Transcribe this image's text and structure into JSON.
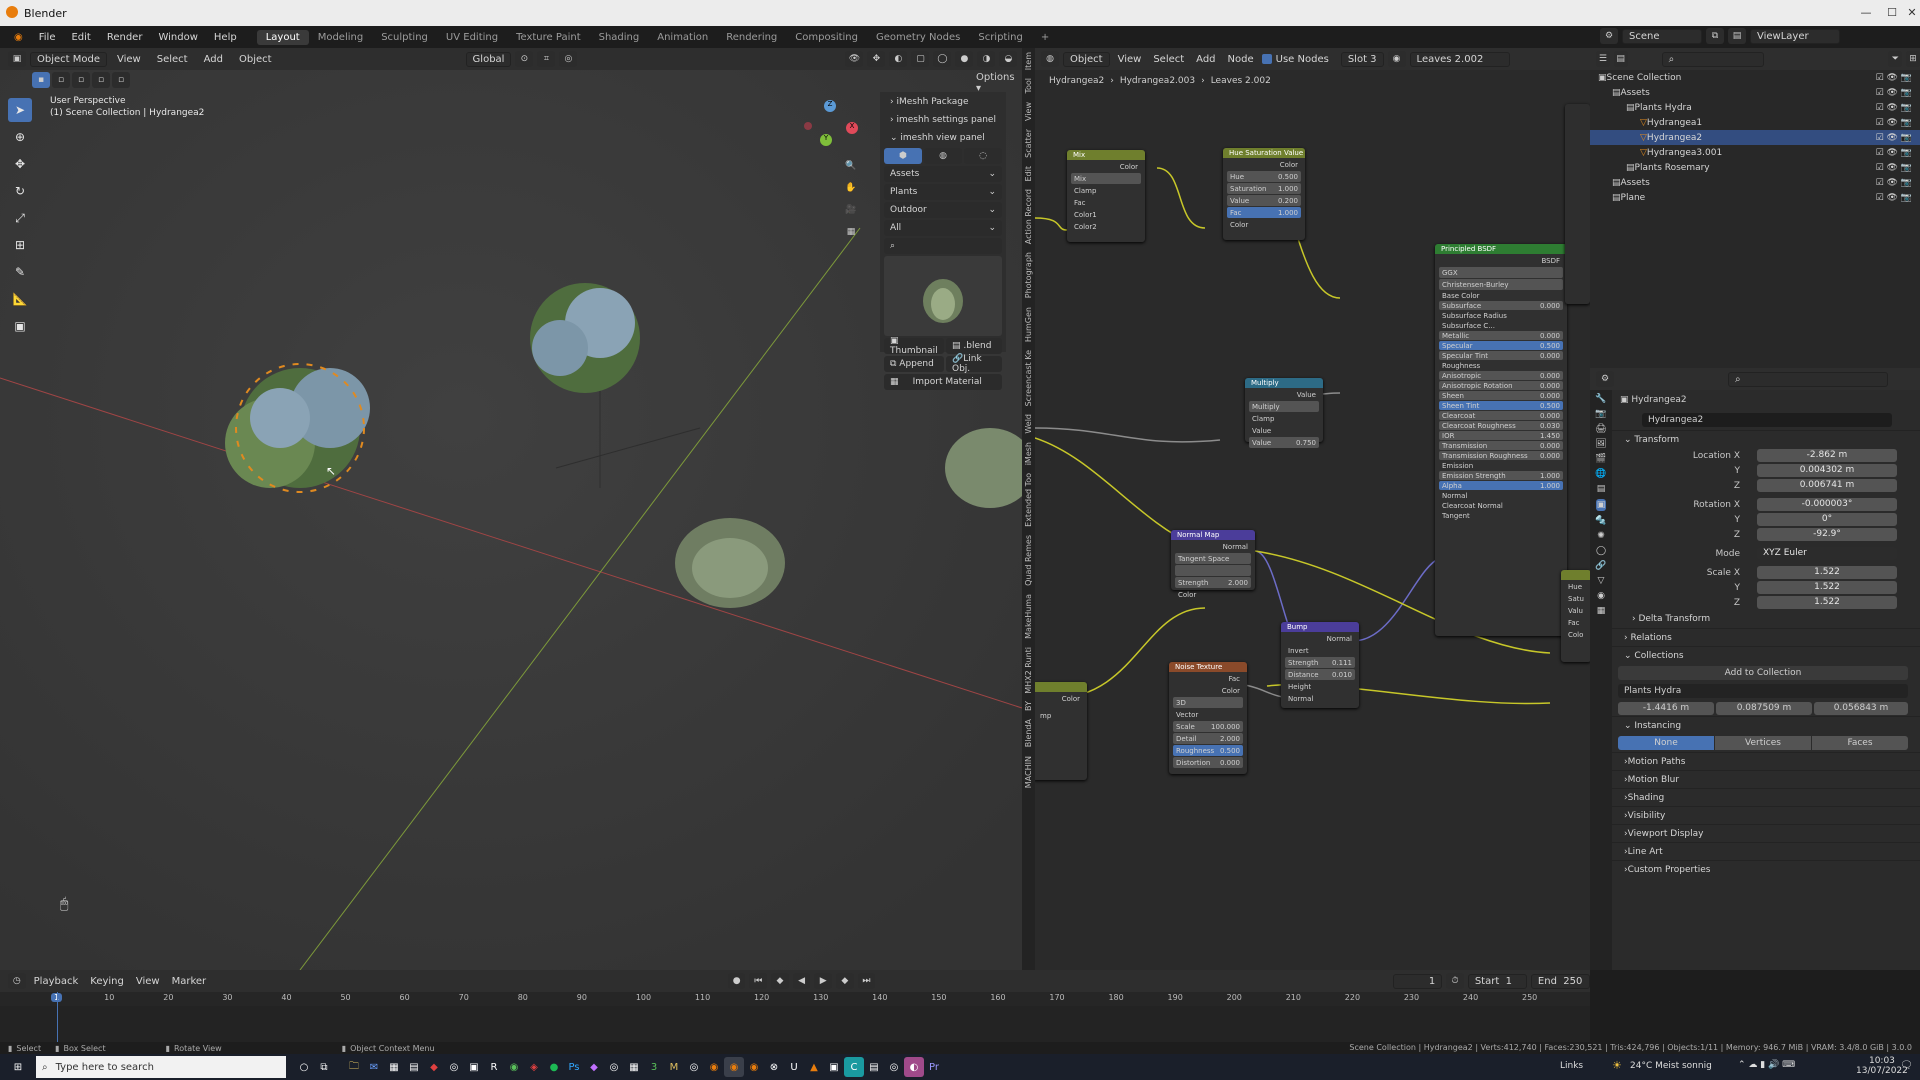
{
  "app": {
    "title": "Blender"
  },
  "menu": [
    "File",
    "Edit",
    "Render",
    "Window",
    "Help"
  ],
  "workspaces": [
    "Layout",
    "Modeling",
    "Sculpting",
    "UV Editing",
    "Texture Paint",
    "Shading",
    "Animation",
    "Rendering",
    "Compositing",
    "Geometry Nodes",
    "Scripting"
  ],
  "workspace_add": "+",
  "viewport": {
    "mode": "Object Mode",
    "menus": [
      "View",
      "Select",
      "Add",
      "Object"
    ],
    "transform": "Global",
    "options": "Options",
    "perspective": "User Perspective",
    "collection": "(1) Scene Collection | Hydrangea2"
  },
  "gizmo": {
    "x": "X",
    "y": "Y",
    "z": "Z"
  },
  "imeshh": {
    "package": "iMeshh Package",
    "settings": "imeshh settings panel",
    "view": "imeshh view panel",
    "dropdowns": [
      "Assets",
      "Plants",
      "Outdoor",
      "All"
    ],
    "thumbnail": "Thumbnail",
    "blend": ".blend",
    "append": "Append",
    "link": "Link Obj.",
    "import": "Import Material"
  },
  "sidebar_tabs": [
    "Item",
    "Tool",
    "View",
    "Scatter",
    "Edit",
    "Action Record",
    "Photograph",
    "HumGen",
    "Screencast Ke",
    "Weld",
    "iMesh",
    "Extended Too",
    "Quad Remes",
    "MakeHuma",
    "MHX2 Runti",
    "BY",
    "BlendA",
    "MACHIN"
  ],
  "node_editor": {
    "menus": [
      "View",
      "Select",
      "Add",
      "Node"
    ],
    "object": "Object",
    "use_nodes": "Use Nodes",
    "slot": "Slot 3",
    "material": "Leaves 2.002",
    "breadcrumb": [
      "Hydrangea2",
      "Hydrangea2.003",
      "Leaves 2.002"
    ]
  },
  "nodes": {
    "mix": {
      "title": "Mix",
      "out": "Color",
      "blend": "Mix",
      "clamp": "Clamp",
      "fac": "Fac",
      "c1": "Color1",
      "c2": "Color2"
    },
    "hsv": {
      "title": "Hue Saturation Value",
      "out": "Color",
      "hue": "Hue",
      "hue_v": "0.500",
      "sat": "Saturation",
      "sat_v": "1.000",
      "val": "Value",
      "val_v": "0.200",
      "fac": "Fac",
      "fac_v": "1.000",
      "color": "Color"
    },
    "bsdf": {
      "title": "Principled BSDF",
      "out": "BSDF",
      "dist": "GGX",
      "sss": "Christensen-Burley",
      "rows": [
        [
          "Base Color",
          ""
        ],
        [
          "Subsurface",
          "0.000"
        ],
        [
          "Subsurface Radius",
          ""
        ],
        [
          "Subsurface C...",
          ""
        ],
        [
          "Metallic",
          "0.000"
        ],
        [
          "Specular",
          "0.500"
        ],
        [
          "Specular Tint",
          "0.000"
        ],
        [
          "Roughness",
          ""
        ],
        [
          "Anisotropic",
          "0.000"
        ],
        [
          "Anisotropic Rotation",
          "0.000"
        ],
        [
          "Sheen",
          "0.000"
        ],
        [
          "Sheen Tint",
          "0.500"
        ],
        [
          "Clearcoat",
          "0.000"
        ],
        [
          "Clearcoat Roughness",
          "0.030"
        ],
        [
          "IOR",
          "1.450"
        ],
        [
          "Transmission",
          "0.000"
        ],
        [
          "Transmission Roughness",
          "0.000"
        ],
        [
          "Emission",
          ""
        ],
        [
          "Emission Strength",
          "1.000"
        ],
        [
          "Alpha",
          "1.000"
        ],
        [
          "Normal",
          ""
        ],
        [
          "Clearcoat Normal",
          ""
        ],
        [
          "Tangent",
          ""
        ]
      ]
    },
    "multiply": {
      "title": "Multiply",
      "out": "Value",
      "op": "Multiply",
      "clamp": "Clamp",
      "v1": "Value",
      "v2": "Value",
      "v2_v": "0.750"
    },
    "normalmap": {
      "title": "Normal Map",
      "out": "Normal",
      "space": "Tangent Space",
      "strength": "Strength",
      "strength_v": "2.000",
      "color": "Color"
    },
    "bump": {
      "title": "Bump",
      "out": "Normal",
      "invert": "Invert",
      "strength": "Strength",
      "strength_v": "0.111",
      "distance": "Distance",
      "distance_v": "0.010",
      "height": "Height",
      "normal": "Normal"
    },
    "noise": {
      "title": "Noise Texture",
      "fac": "Fac",
      "color": "Color",
      "dim": "3D",
      "vector": "Vector",
      "scale": "Scale",
      "scale_v": "100.000",
      "detail": "Detail",
      "detail_v": "2.000",
      "rough": "Roughness",
      "rough_v": "0.500",
      "distortion": "Distortion",
      "distortion_v": "0.000"
    },
    "partial": {
      "color": "Color",
      "mp": "mp"
    },
    "right_partial": [
      "Hue",
      "Satu",
      "Valu",
      "Fac",
      "Colo"
    ]
  },
  "outliner": {
    "scene": "Scene",
    "viewlayer": "ViewLayer",
    "rows": [
      {
        "label": "Scene Collection",
        "indent": 0
      },
      {
        "label": "Assets",
        "indent": 1
      },
      {
        "label": "Plants Hydra",
        "indent": 2
      },
      {
        "label": "Hydrangea1",
        "indent": 3
      },
      {
        "label": "Hydrangea2",
        "indent": 3,
        "sel": true
      },
      {
        "label": "Hydrangea3.001",
        "indent": 3
      },
      {
        "label": "Plants Rosemary",
        "indent": 2
      },
      {
        "label": "Assets",
        "indent": 1
      },
      {
        "label": "Plane",
        "indent": 1
      }
    ]
  },
  "properties": {
    "object": "Hydrangea2",
    "name_field": "Hydrangea2",
    "transform": "Transform",
    "location_label": "Location X",
    "loc": [
      "-2.862 m",
      "0.004302 m",
      "0.006741 m"
    ],
    "rotation_label": "Rotation X",
    "rot": [
      "-0.000003°",
      "0°",
      "-92.9°"
    ],
    "mode_label": "Mode",
    "mode": "XYZ Euler",
    "scale_label": "Scale X",
    "scale": [
      "1.522",
      "1.522",
      "1.522"
    ],
    "y": "Y",
    "z": "Z",
    "delta": "Delta Transform",
    "relations": "Relations",
    "collections": "Collections",
    "add_collection": "Add to Collection",
    "coll_name": "Plants Hydra",
    "offset": [
      "-1.4416 m",
      "0.087509 m",
      "0.056843 m"
    ],
    "instancing": "Instancing",
    "inst": [
      "None",
      "Vertices",
      "Faces"
    ],
    "sections": [
      "Motion Paths",
      "Motion Blur",
      "Shading",
      "Visibility",
      "Viewport Display",
      "Line Art",
      "Custom Properties"
    ]
  },
  "timeline": {
    "menus": [
      "Playback",
      "Keying",
      "View",
      "Marker"
    ],
    "frame": "1",
    "start_label": "Start",
    "start": "1",
    "end_label": "End",
    "end": "250",
    "ticks": [
      "1",
      "10",
      "20",
      "30",
      "40",
      "50",
      "60",
      "70",
      "80",
      "90",
      "100",
      "110",
      "120",
      "130",
      "140",
      "150",
      "160",
      "170",
      "180",
      "190",
      "200",
      "210",
      "220",
      "230",
      "240",
      "250"
    ]
  },
  "status": {
    "left": [
      "Select",
      "Box Select",
      "Rotate View",
      "Object Context Menu"
    ],
    "right": "Scene Collection | Hydrangea2 | Verts:412,740 | Faces:230,521 | Tris:424,796 | Objects:1/11 | Memory: 946.7 MiB | VRAM: 3.4/8.0 GiB | 3.0.0"
  },
  "taskbar": {
    "search": "Type here to search",
    "links": "Links",
    "weather": "24°C  Meist sonnig",
    "time": "10:03",
    "date": "13/07/2022"
  }
}
